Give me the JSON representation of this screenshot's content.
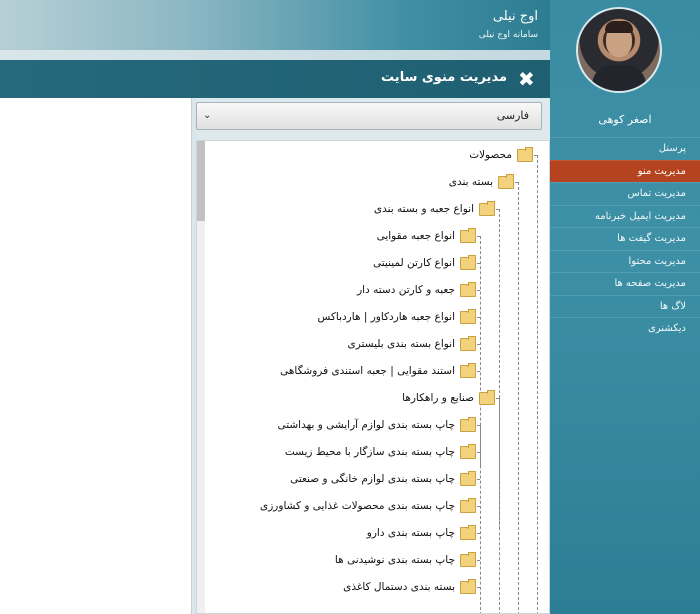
{
  "header": {
    "title": "اوج نیلی",
    "subtitle": "سامانه اوج نیلی"
  },
  "user": {
    "name": "اصغر کوهی"
  },
  "sidebar": {
    "items": [
      {
        "label": "پرسنل",
        "active": false
      },
      {
        "label": "مدیریت منو",
        "active": true
      },
      {
        "label": "مدیریت تماس",
        "active": false
      },
      {
        "label": "مدیریت ایمیل خبرنامه",
        "active": false
      },
      {
        "label": "مدیریت گیفت ها",
        "active": false
      },
      {
        "label": "مدیریت محتوا",
        "active": false
      },
      {
        "label": "مدیریت صفحه ها",
        "active": false
      },
      {
        "label": "لاگ ها",
        "active": false
      },
      {
        "label": "دیکشنری",
        "active": false
      }
    ]
  },
  "modal": {
    "title": "مدیریت منوی سایت",
    "close_icon": "close-icon",
    "language_select": {
      "value": "فارسی"
    }
  },
  "tree": {
    "nodes": [
      {
        "label": "محصولات",
        "level": 0
      },
      {
        "label": "بسته بندی",
        "level": 1
      },
      {
        "label": "انواع جعبه و بسته بندی",
        "level": 2
      },
      {
        "label": "انواع جعبه مقوایی",
        "level": 3
      },
      {
        "label": "انواع کارتن لمینیتی",
        "level": 3
      },
      {
        "label": "جعبه و کارتن دسته دار",
        "level": 3
      },
      {
        "label": "انواع جعبه هاردکاور | هاردباکس",
        "level": 3
      },
      {
        "label": "انواع بسته بندی بلیستری",
        "level": 3
      },
      {
        "label": "استند مقوایی | جعبه استندی فروشگاهی",
        "level": 3
      },
      {
        "label": "صنایع و راهکارها",
        "level": 2
      },
      {
        "label": "چاپ بسته بندی لوازم آرایشی و بهداشتی",
        "level": 3
      },
      {
        "label": "چاپ بسته بندی سازگار با محیط زیست",
        "level": 3
      },
      {
        "label": "چاپ بسته بندی لوازم خانگی و صنعتی",
        "level": 3
      },
      {
        "label": "چاپ بسته بندی محصولات غذایی و کشاورزی",
        "level": 3
      },
      {
        "label": "چاپ بسته بندی دارو",
        "level": 3
      },
      {
        "label": "چاپ بسته بندی نوشیدنی ها",
        "level": 3
      },
      {
        "label": "بسته بندی دستمال کاغذی",
        "level": 3
      }
    ]
  },
  "colors": {
    "sidebar_bg": "#3a8ca2",
    "active_menu": "#b5431f",
    "modal_header": "#26697c",
    "folder": "#f2d27c"
  }
}
